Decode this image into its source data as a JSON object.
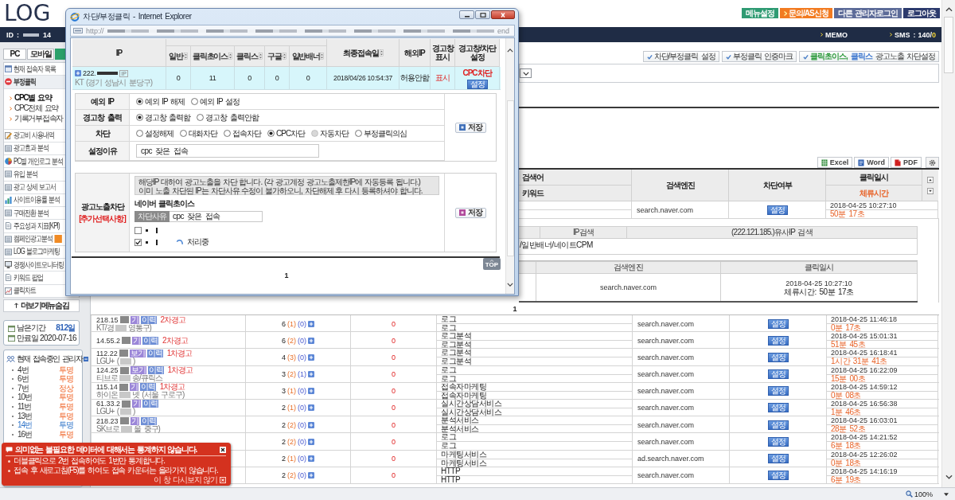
{
  "browser": {
    "zoom": "100%"
  },
  "header": {
    "logo": "LOG",
    "buttons": [
      {
        "label": "메뉴설정",
        "color": "#2f9b73",
        "arrow": false
      },
      {
        "label": "문의/AS신청",
        "color": "#f27b21",
        "arrow": true
      },
      {
        "label": "다른 관리자로그인",
        "color": "#5c6b98",
        "arrow": false
      },
      {
        "label": "로그아웃",
        "color": "#2c3a6d",
        "arrow": false
      }
    ]
  },
  "navbar": {
    "id_label": "ID :",
    "id_tail": "14",
    "memo": "MEMO",
    "sms_label": "SMS :",
    "sms_count": "140/",
    "sms_remaining": "0"
  },
  "sidebar": {
    "tabs": [
      {
        "label": "PC",
        "selected": false
      },
      {
        "label": "모바일",
        "selected": false
      },
      {
        "selected": true
      }
    ],
    "menu": [
      {
        "label": "현재 접속자 목록",
        "expanded": false,
        "badge": false
      },
      {
        "label": "부정클릭",
        "expanded": true,
        "badge": false,
        "children": [
          {
            "label": "CPC별 요약",
            "selected": true
          },
          {
            "label": "CPC전체 요약",
            "selected": false
          },
          {
            "label": "기록거부접속자",
            "selected": false
          }
        ]
      },
      {
        "label": "광고비 사용내역",
        "expanded": false,
        "badge": false
      },
      {
        "label": "광고효과 분석",
        "expanded": false,
        "badge": false
      },
      {
        "label": "PC별 개인로그 분석",
        "expanded": false,
        "badge": false
      },
      {
        "label": "유입 분석",
        "expanded": false,
        "badge": false
      },
      {
        "label": "광고 상세 보고서",
        "expanded": false,
        "badge": false
      },
      {
        "label": "사이트이용률 분석",
        "expanded": false,
        "badge": false
      },
      {
        "label": "구매전환 분석",
        "expanded": false,
        "badge": false
      },
      {
        "label": "주요성과 지표(KPI)",
        "expanded": false,
        "badge": false
      },
      {
        "label": "캠페인광고분석",
        "expanded": false,
        "badge": true
      },
      {
        "label": "LOG 블로그마케팅",
        "expanded": false,
        "badge": false
      },
      {
        "label": "경쟁사이트모니터링",
        "expanded": false,
        "badge": false
      },
      {
        "label": "키워드 팝업",
        "expanded": false,
        "badge": false
      },
      {
        "label": "클릭차트",
        "expanded": false,
        "badge": false
      }
    ],
    "more_button": "더보기메뉴숨김",
    "subscription": [
      {
        "label": "남은기간",
        "value": "812일",
        "kind": "remaining"
      },
      {
        "label": "만료일",
        "value": "2020-07-16",
        "kind": "expiry"
      }
    ],
    "admins": {
      "title": "현재 접속중인 관리자",
      "items": [
        {
          "name": "4번",
          "status": "투명",
          "selected": false
        },
        {
          "name": "6번",
          "status": "투명",
          "selected": false
        },
        {
          "name": "7번",
          "status": "정상",
          "selected": false
        },
        {
          "name": "10번",
          "status": "투명",
          "selected": false
        },
        {
          "name": "11번",
          "status": "투명",
          "selected": false
        },
        {
          "name": "13번",
          "status": "투명",
          "selected": false
        },
        {
          "name": "14번",
          "status": "투명",
          "selected": true
        },
        {
          "name": "16번",
          "status": "투명",
          "selected": false
        }
      ]
    }
  },
  "main": {
    "toolbar": [
      {
        "segments": [
          {
            "text": "차단/부정클릭 설정"
          }
        ]
      },
      {
        "segments": [
          {
            "text": "부정클릭 인증마크"
          }
        ]
      },
      {
        "segments": [
          {
            "text": "클릭초이스,",
            "color": "#2e9a3c"
          },
          {
            "text": "클릭스",
            "color": "#3f78cf"
          },
          {
            "text": "광고노출 차단설정"
          }
        ]
      }
    ],
    "export_buttons": [
      {
        "label": "Excel",
        "kind": "excel"
      },
      {
        "label": "Word",
        "kind": "word"
      },
      {
        "label": "PDF",
        "kind": "pdf"
      }
    ],
    "columns": [
      {
        "label": "검색어",
        "sub": "키워드"
      },
      {
        "label": "검색엔진"
      },
      {
        "label": "차단여부"
      },
      {
        "label": "클릭일시",
        "sub": "체류시간"
      }
    ],
    "first_row": {
      "engine": "search.naver.com",
      "action": "설정",
      "date": "2018-04-25 10:27:10",
      "duration": "50분 17초"
    },
    "detail": {
      "ip_search": "IP검색",
      "similar_ip": "(222.121.185.)유사IP 검색",
      "note": "/일반배너/네이트CPM",
      "columns": [
        "검색엔진",
        "클릭일시"
      ],
      "engine": "search.naver.com",
      "date": "2018-04-25 10:27:10",
      "duration": "체류시간: 50분 17초"
    },
    "pagination": "1",
    "rows": [
      {
        "ip": "218.15",
        "isp": "KT/경",
        "region": "영통구)",
        "view": "기",
        "history": "이력",
        "warning": "2차경고",
        "count": "6",
        "count_a": "(1)",
        "count_b": "(0)",
        "blocked": "0",
        "search_term": "로그",
        "keyword": "로그",
        "engine": "search.naver.com",
        "action": "설정",
        "date": "2018-04-25 11:46:18",
        "duration": "0분 17초"
      },
      {
        "ip": "14.55.2",
        "view": "기",
        "history": "이력",
        "warning": "2차경고",
        "count": "6",
        "count_a": "(2)",
        "count_b": "(0)",
        "blocked": "0",
        "search_term": "로그분석",
        "keyword": "로그분석",
        "engine": "search.naver.com",
        "action": "설정",
        "date": "2018-04-25 15:01:31",
        "duration": "51분 45초"
      },
      {
        "ip": "112.22",
        "isp": "LGU+ (",
        "region": ")",
        "view": "보기",
        "history": "이력",
        "warning": "1차경고",
        "count": "4",
        "count_a": "(3)",
        "count_b": "(0)",
        "blocked": "0",
        "search_term": "로그분석",
        "keyword": "로그분석",
        "engine": "search.naver.com",
        "action": "설정",
        "date": "2018-04-25 16:18:41",
        "duration": "1시간 31분 41초"
      },
      {
        "ip": "124.25",
        "isp": "티브로",
        "region": "송/큐릭스",
        "view": "보기",
        "history": "이력",
        "warning": "1차경고",
        "count": "3",
        "count_a": "(2)",
        "count_b": "(1)",
        "blocked": "0",
        "search_term": "로그",
        "keyword": "로그",
        "engine": "search.naver.com",
        "action": "설정",
        "date": "2018-04-25 16:22:09",
        "duration": "15분 00초"
      },
      {
        "ip": "115.14",
        "isp": "하이온",
        "region": "넷 (서울 구로구)",
        "view": "기",
        "history": "이력",
        "warning": "1차경고",
        "count": "3",
        "count_a": "(1)",
        "count_b": "(0)",
        "blocked": "0",
        "search_term": "접속자마케팅",
        "keyword": "접속자마케팅",
        "engine": "search.naver.com",
        "action": "설정",
        "date": "2018-04-25 14:59:12",
        "duration": "0분 08초"
      },
      {
        "ip": "61.33.2",
        "isp": "LGU+ (",
        "region": ")",
        "view": "기",
        "history": "이력",
        "count": "2",
        "count_a": "(1)",
        "count_b": "(0)",
        "blocked": "0",
        "search_term": "실시간상담서비스",
        "keyword": "실시간상담서비스",
        "engine": "search.naver.com",
        "action": "설정",
        "date": "2018-04-25 16:56:38",
        "duration": "1분 46초"
      },
      {
        "ip": "218.23",
        "isp": "SK브로",
        "region": "울 중구)",
        "view": "기",
        "history": "이력",
        "count": "2",
        "count_a": "(2)",
        "count_b": "(0)",
        "blocked": "0",
        "search_term": "분석서비스",
        "keyword": "분석서비스",
        "engine": "search.naver.com",
        "action": "설정",
        "date": "2018-04-25 16:03:01",
        "duration": "28분 52초"
      },
      {
        "count": "2",
        "count_a": "(2)",
        "count_b": "(0)",
        "blocked": "0",
        "search_term": "로그",
        "keyword": "로그",
        "engine": "search.naver.com",
        "action": "설정",
        "date": "2018-04-25 14:21:52",
        "duration": "6분 18초"
      },
      {
        "count": "2",
        "count_a": "(1)",
        "count_b": "(0)",
        "blocked": "0",
        "search_term": "마케팅서비스",
        "keyword": "마케팅서비스",
        "engine": "ad.search.naver.com",
        "action": "설정",
        "date": "2018-04-25 12:26:02",
        "duration": "0분 18초"
      },
      {
        "count": "2",
        "count_a": "(2)",
        "count_b": "(0)",
        "blocked": "0",
        "search_term": "HTTP",
        "keyword": "HTTP",
        "engine": "search.naver.com",
        "action": "설정",
        "date": "2018-04-25 14:16:19",
        "duration": "6분 19초"
      }
    ]
  },
  "popup": {
    "title": "차단/부정클릭 - Internet Explorer",
    "address": "http://",
    "address_end": "end",
    "columns": [
      {
        "label": "IP",
        "sortable": false
      },
      {
        "label": "일반",
        "sortable": true
      },
      {
        "label": "클릭초이스",
        "sortable": true
      },
      {
        "label": "클릭스",
        "sortable": true
      },
      {
        "label": "구글",
        "sortable": true
      },
      {
        "label": "일반배너",
        "sortable": true
      },
      {
        "label": "최종접속일",
        "sortable": true
      },
      {
        "label": "해외IP",
        "sortable": false
      },
      {
        "label": "경고창 표시",
        "sortable": false
      },
      {
        "label": "경고창/차단 설정",
        "sortable": false
      }
    ],
    "row": {
      "selected": true,
      "ip": "222.",
      "ip_tag": "IP",
      "isp": "KT (경기 성남시 분당구)",
      "counts": [
        "0",
        "11",
        "0",
        "0",
        "0"
      ],
      "last_visit": "2018/04/26 10:54:37",
      "foreign_ip": "허용안함",
      "warning": "표시",
      "block": "CPC차단",
      "button": "설정"
    },
    "settings": [
      {
        "label": "예외 IP",
        "kind": "radio",
        "options": [
          {
            "label": "예외 IP 해제",
            "selected": true,
            "disabled": false
          },
          {
            "label": "예외 IP 설정",
            "selected": false,
            "disabled": false
          }
        ]
      },
      {
        "label": "경고창 출력",
        "kind": "radio",
        "options": [
          {
            "label": "경고창 출력함",
            "selected": true,
            "disabled": false
          },
          {
            "label": "경고창 출력안함",
            "selected": false,
            "disabled": false
          }
        ]
      },
      {
        "label": "차단",
        "kind": "radio",
        "options": [
          {
            "label": "설정해제",
            "selected": false,
            "disabled": false
          },
          {
            "label": "대화차단",
            "selected": false,
            "disabled": false
          },
          {
            "label": "접속차단",
            "selected": false,
            "disabled": false
          },
          {
            "label": "CPC차단",
            "selected": true,
            "disabled": false
          },
          {
            "label": "자동차단",
            "selected": false,
            "disabled": true
          },
          {
            "label": "부정클릭의심",
            "selected": false,
            "disabled": false
          }
        ]
      },
      {
        "label": "설정이유",
        "kind": "text",
        "value": "cpc 잦은 접속"
      }
    ],
    "save": "저장",
    "ad_block": {
      "label": "광고노출차단",
      "note": "[추가선택사항]",
      "info": [
        "해당IP 대하여 광고노출을 차단 합니다. (각 광고계정 광고노출제한IP에 자동등록 됩니다.)",
        "이미 노출 차단된 IP는 차단사유 수정이 불가하오니, 차단해제 후 다시 등록하셔야 합니다."
      ],
      "network": "네이버 클릭초이스",
      "reason_label": "차단사유",
      "reason": "cpc 잦은 접속",
      "accounts": [
        {
          "checked": false
        },
        {
          "checked": true,
          "status": "처리중"
        }
      ],
      "save": "저장"
    },
    "top": "TOP",
    "pagination": "1"
  },
  "notice": {
    "title": "의미없는 불필요한 데이터에 대해서는 통계하지 않습니다.",
    "items": [
      "더블클릭으로 2번 접속하여도 1번만 통계합니다.",
      "접속 후 새로고침(F5)를 하여도 접속 카운터는 올라가지 않습니다."
    ],
    "dismiss": "이 창 다시보지 않기"
  }
}
